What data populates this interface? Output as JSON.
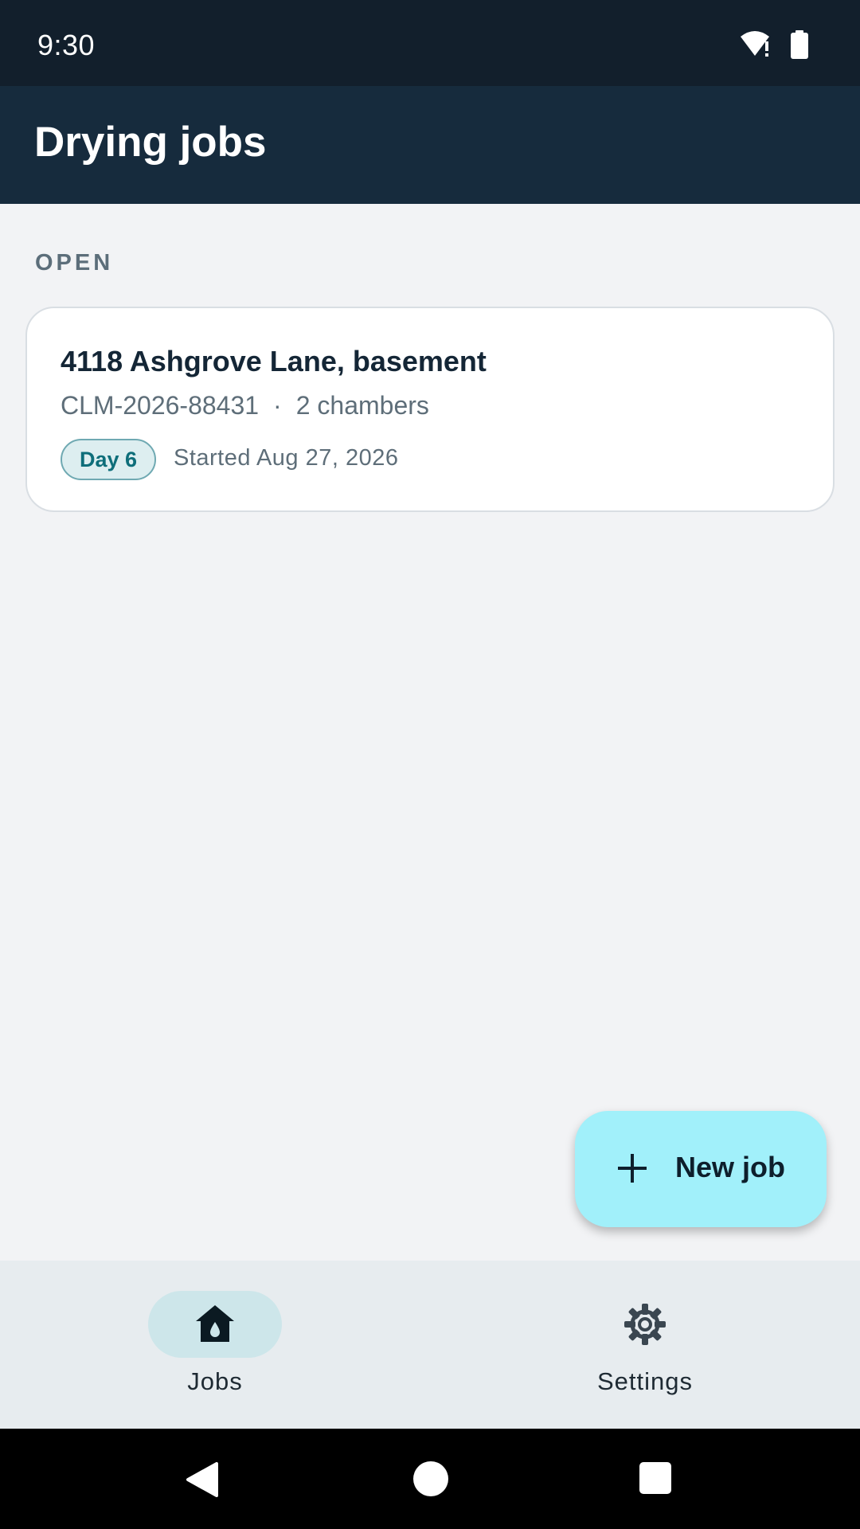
{
  "status_bar": {
    "time": "9:30",
    "icons": [
      "wifi-alert-icon",
      "battery-icon"
    ]
  },
  "app_bar": {
    "title": "Drying jobs"
  },
  "section": {
    "header": "OPEN"
  },
  "jobs": [
    {
      "address": "4118 Ashgrove Lane, basement",
      "claim_number": "CLM-2026-88431",
      "separator": "·",
      "chambers": "2 chambers",
      "day_badge": "Day 6",
      "started": "Started Aug 27, 2026"
    }
  ],
  "fab": {
    "icon": "plus-icon",
    "label": "New job"
  },
  "bottom_nav": {
    "items": [
      {
        "label": "Jobs",
        "icon": "home-drop-icon",
        "selected": true
      },
      {
        "label": "Settings",
        "icon": "gear-icon",
        "selected": false
      }
    ]
  },
  "system_nav": {
    "buttons": [
      "back-icon",
      "home-icon",
      "recents-icon"
    ]
  },
  "colors": {
    "status_bar": "#121F2C",
    "app_bar": "#162B3D",
    "background": "#F2F3F5",
    "fab": "#A1F0FA",
    "badge_text": "#0E6E7A",
    "nav_pill": "#CDE6EA"
  }
}
